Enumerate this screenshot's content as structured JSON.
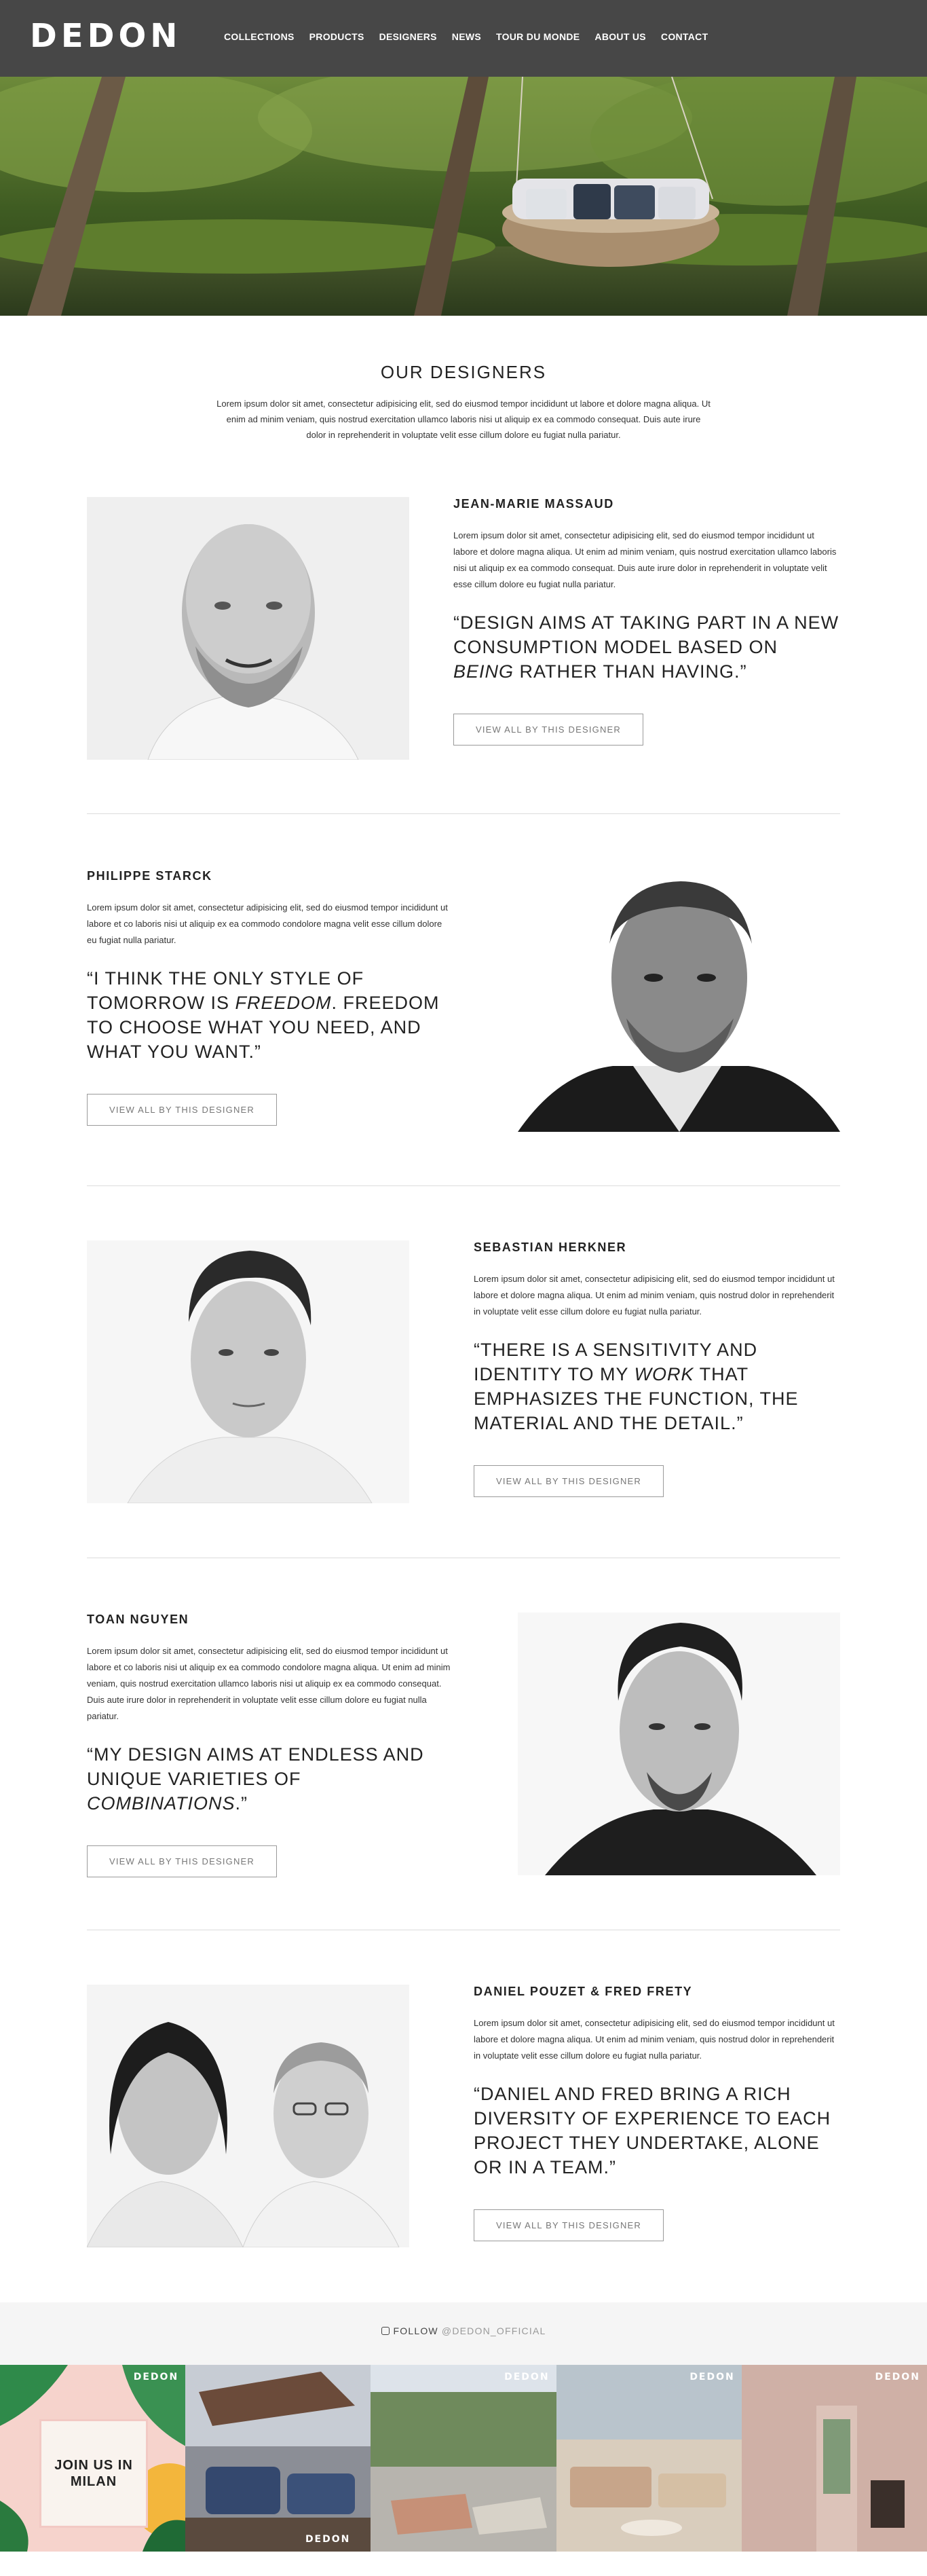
{
  "brand": {
    "logo": "DEDON"
  },
  "nav": [
    "COLLECTIONS",
    "PRODUCTS",
    "DESIGNERS",
    "NEWS",
    "TOUR DU MONDE",
    "ABOUT US",
    "CONTACT"
  ],
  "intro": {
    "title": "OUR DESIGNERS",
    "text": "Lorem ipsum dolor sit amet, consectetur adipisicing elit, sed do eiusmod tempor incididunt ut labore et dolore magna aliqua. Ut enim ad minim veniam, quis nostrud exercitation ullamco laboris nisi ut aliquip ex ea commodo consequat. Duis aute irure dolor in reprehenderit in voluptate velit esse cillum dolore eu fugiat nulla pariatur."
  },
  "designers": [
    {
      "name": "JEAN-MARIE MASSAUD",
      "bio": "Lorem ipsum dolor sit amet, consectetur adipisicing elit, sed do eiusmod tempor incididunt ut labore et dolore magna aliqua. Ut enim ad minim veniam, quis nostrud exercitation ullamco laboris nisi ut aliquip ex ea commodo consequat. Duis aute irure dolor in reprehenderit in voluptate velit esse cillum dolore eu fugiat nulla pariatur.",
      "quote_before": "“DESIGN AIMS AT TAKING PART IN A NEW CONSUMPTION MODEL BASED ON ",
      "quote_em": "BEING",
      "quote_after": " RATHER THAN HAVING.”",
      "button": "VIEW ALL BY THIS DESIGNER"
    },
    {
      "name": "PHILIPPE STARCK",
      "bio": "Lorem ipsum dolor sit amet, consectetur adipisicing elit, sed do eiusmod tempor incididunt ut labore et co laboris nisi ut aliquip ex ea commodo condolore magna velit esse cillum dolore eu fugiat nulla pariatur.",
      "quote_before": "“I THINK THE ONLY STYLE OF TOMORROW IS ",
      "quote_em": "FREEDOM",
      "quote_after": ". FREEDOM TO CHOOSE WHAT YOU NEED, AND WHAT YOU WANT.”",
      "button": "VIEW ALL BY THIS DESIGNER"
    },
    {
      "name": "SEBASTIAN HERKNER",
      "bio": "Lorem ipsum dolor sit amet, consectetur adipisicing elit, sed do eiusmod tempor incididunt ut labore et dolore magna aliqua. Ut enim ad minim veniam, quis nostrud dolor in reprehenderit in voluptate velit esse cillum dolore eu fugiat nulla pariatur.",
      "quote_before": "“THERE IS A SENSITIVITY AND IDENTITY TO MY ",
      "quote_em": "WORK",
      "quote_after": " THAT EMPHASIZES THE FUNCTION, THE MATERIAL AND THE DETAIL.”",
      "button": "VIEW ALL BY THIS DESIGNER"
    },
    {
      "name": "TOAN NGUYEN",
      "bio": "Lorem ipsum dolor sit amet, consectetur adipisicing elit, sed do eiusmod tempor incididunt ut labore et co laboris nisi ut aliquip ex ea commodo condolore magna aliqua. Ut enim ad minim veniam, quis nostrud exercitation ullamco laboris nisi ut aliquip ex ea commodo consequat. Duis aute irure dolor in reprehenderit in voluptate velit esse cillum dolore eu fugiat nulla pariatur.",
      "quote_before": "“MY DESIGN AIMS AT ENDLESS AND UNIQUE VARIETIES OF ",
      "quote_em": "COMBINATIONS",
      "quote_after": ".”",
      "button": "VIEW ALL BY THIS DESIGNER"
    },
    {
      "name": "DANIEL POUZET & FRED FRETY",
      "bio": "Lorem ipsum dolor sit amet, consectetur adipisicing elit, sed do eiusmod tempor incididunt ut labore et dolore magna aliqua. Ut enim ad minim veniam, quis nostrud dolor in reprehenderit in voluptate velit esse cillum dolore eu fugiat nulla pariatur.",
      "quote_before": "“DANIEL AND FRED BRING A RICH DIVERSITY OF EXPERIENCE TO EACH PROJECT THEY UNDERTAKE, ALONE OR IN A TEAM.”",
      "quote_em": "",
      "quote_after": "",
      "button": "VIEW ALL BY THIS DESIGNER"
    }
  ],
  "follow": {
    "label": "FOLLOW",
    "handle": "@DEDON_OFFICIAL",
    "icon": "instagram-icon"
  },
  "instagram": {
    "join_text": "JOIN US IN MILAN",
    "tile_logo": "DEDON"
  },
  "colors": {
    "header": "#474747",
    "divider": "#dcdcdc",
    "button_border": "#9a9a9a"
  }
}
